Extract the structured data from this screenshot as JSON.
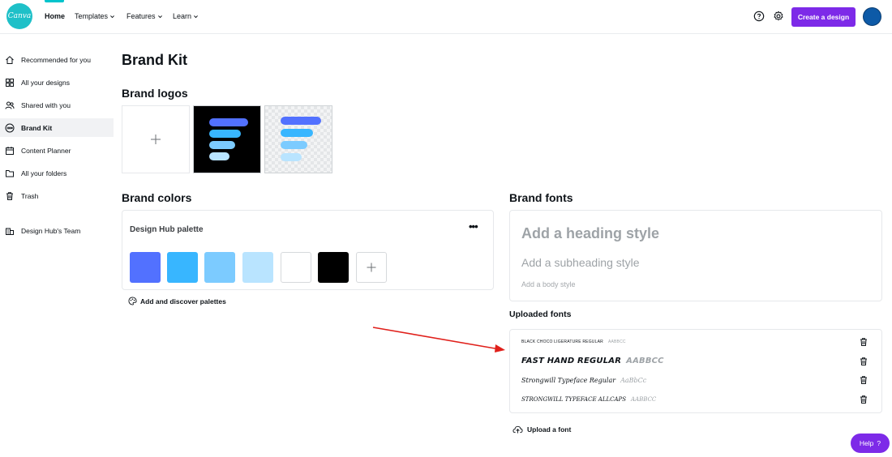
{
  "topbar": {
    "logo_text": "Canva",
    "nav": {
      "home": "Home",
      "templates": "Templates",
      "features": "Features",
      "learn": "Learn"
    },
    "create_button": "Create a design"
  },
  "sidebar": {
    "items": [
      {
        "label": "Recommended for you",
        "icon": "home-icon"
      },
      {
        "label": "All your designs",
        "icon": "grid-icon"
      },
      {
        "label": "Shared with you",
        "icon": "people-icon"
      },
      {
        "label": "Brand Kit",
        "icon": "brand-kit-icon",
        "active": true
      },
      {
        "label": "Content Planner",
        "icon": "calendar-icon"
      },
      {
        "label": "All your folders",
        "icon": "folder-icon"
      },
      {
        "label": "Trash",
        "icon": "trash-icon"
      }
    ],
    "team": {
      "label": "Design Hub's Team",
      "icon": "building-icon"
    }
  },
  "main": {
    "title": "Brand Kit",
    "logos_heading": "Brand logos",
    "colors_heading": "Brand colors",
    "palette": {
      "name": "Design Hub palette",
      "colors": [
        "#5271ff",
        "#38b6ff",
        "#7ccbff",
        "#b9e4ff",
        "#ffffff",
        "#000000"
      ]
    },
    "discover_palettes": "Add and discover palettes",
    "fonts_heading": "Brand fonts",
    "heading_style": "Add a heading style",
    "subheading_style": "Add a subheading style",
    "body_style": "Add a body style",
    "uploaded_fonts_heading": "Uploaded fonts",
    "uploaded_fonts": [
      {
        "name": "BLACK CHOCO LIGERATURE REGULAR",
        "sample": "AABBCC"
      },
      {
        "name": "FAST HAND REGULAR",
        "sample": "AABBCC"
      },
      {
        "name": "Strongwill Typeface Regular",
        "sample": "AaBbCc"
      },
      {
        "name": "STRONGWILL TYPEFACE ALLCAPS",
        "sample": "AABBCC"
      }
    ],
    "upload_font": "Upload a font"
  },
  "help_button": "Help",
  "colors": {
    "accent": "#7d2ae8",
    "logo": "#1ec0c8",
    "arrow": "#e0201b"
  }
}
